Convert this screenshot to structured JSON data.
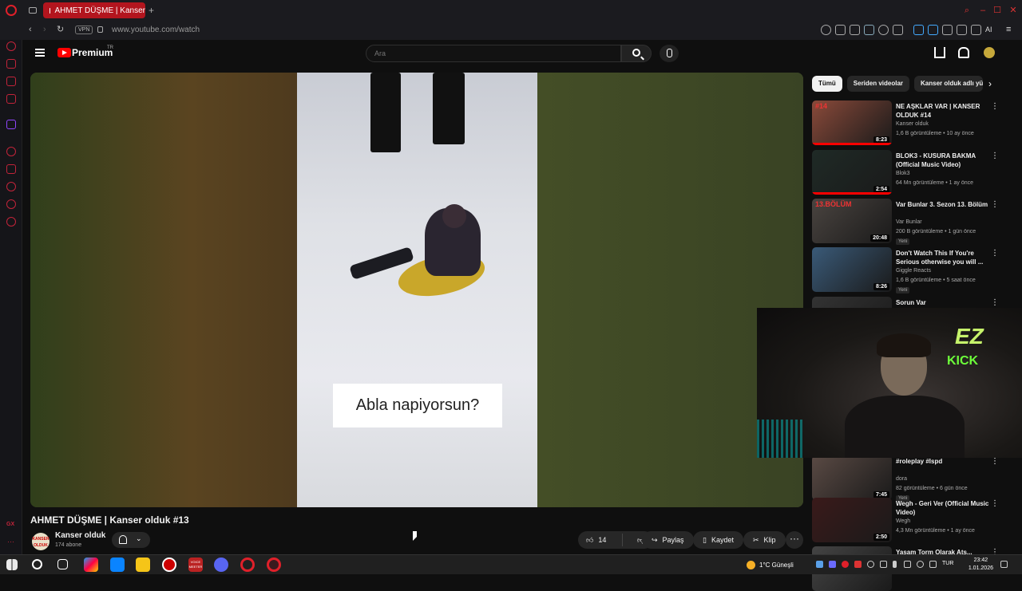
{
  "browser": {
    "tab_title": "AHMET DÜŞME | Kanser",
    "new_tab": "+",
    "vpn_label": "VPN",
    "url": "www.youtube.com/watch",
    "ai_label": "AI"
  },
  "youtube": {
    "brand": "Premium",
    "brand_region": "TR",
    "search_placeholder": "Ara"
  },
  "video": {
    "caption": "Abla napiyorsun?",
    "title": "AHMET DÜŞME | Kanser olduk #13",
    "channel_name": "Kanser olduk",
    "channel_avatar_text": "KANSER OLDUK",
    "subscribers": "174 abone",
    "likes": "14",
    "share_label": "Paylaş",
    "save_label": "Kaydet",
    "clip_label": "Klip"
  },
  "chips": [
    "Tümü",
    "Seriden videolar",
    "Kanser olduk adlı yük"
  ],
  "recommendations": [
    {
      "title": "NE AŞKLAR VAR | KANSER OLDUK #14",
      "channel": "Kanser olduk",
      "meta": "1,6 B görüntüleme • 10 ay önce",
      "duration": "8:23",
      "badge": "",
      "thumb_color": "#8a4a3a",
      "thumb_overlay": "#14",
      "progress": 1.0
    },
    {
      "title": "BLOK3 - KUSURA BAKMA (Official Music Video)",
      "channel": "Blok3",
      "meta": "64 Mn görüntüleme • 1 ay önce",
      "duration": "2:54",
      "badge": "",
      "thumb_color": "#1f2a26",
      "thumb_overlay": "",
      "progress": 1.0
    },
    {
      "title": "Var Bunlar 3. Sezon 13. Bölüm",
      "channel": "Var Bunlar",
      "meta": "200 B görüntüleme • 1 gün önce",
      "duration": "20:48",
      "badge": "Yeni",
      "thumb_color": "#4a4440",
      "thumb_overlay": "13.BÖLÜM",
      "progress": 0
    },
    {
      "title": "Don't Watch This If You're Serious otherwise you will ...",
      "channel": "Giggle Reacts",
      "meta": "1,6 B görüntüleme • 5 saat önce",
      "duration": "8:26",
      "badge": "Yeni",
      "thumb_color": "#3a5a78",
      "thumb_overlay": "",
      "progress": 0
    },
    {
      "title": "Sorun Var",
      "channel": "",
      "meta": "",
      "duration": "",
      "badge": "",
      "thumb_color": "#333",
      "thumb_overlay": "",
      "progress": 0
    },
    {
      "title": "#roleplay #lspd",
      "channel": "dora",
      "meta": "82 görüntüleme • 6 gün önce",
      "duration": "7:45",
      "badge": "Yeni",
      "thumb_color": "#5a4a44",
      "thumb_overlay": "",
      "progress": 0
    },
    {
      "title": "Wegh - Geri Ver (Official Music Video)",
      "channel": "Wegh",
      "meta": "4,3 Mn görüntüleme • 1 ay önce",
      "duration": "2:50",
      "badge": "",
      "thumb_color": "#3a1a1a",
      "thumb_overlay": "",
      "progress": 0
    },
    {
      "title": "Yasam Torm Olarak Ats...",
      "channel": "",
      "meta": "",
      "duration": "",
      "badge": "",
      "thumb_color": "#444",
      "thumb_overlay": "",
      "progress": 0
    }
  ],
  "webcam": {
    "logo_top": "EZ",
    "logo_bottom": "KICK"
  },
  "taskbar": {
    "weather": "1°C  Güneşli",
    "lang": "TUR",
    "time": "23:42",
    "date": "1.01.2026",
    "voice_app": "VOICE MEETER"
  }
}
